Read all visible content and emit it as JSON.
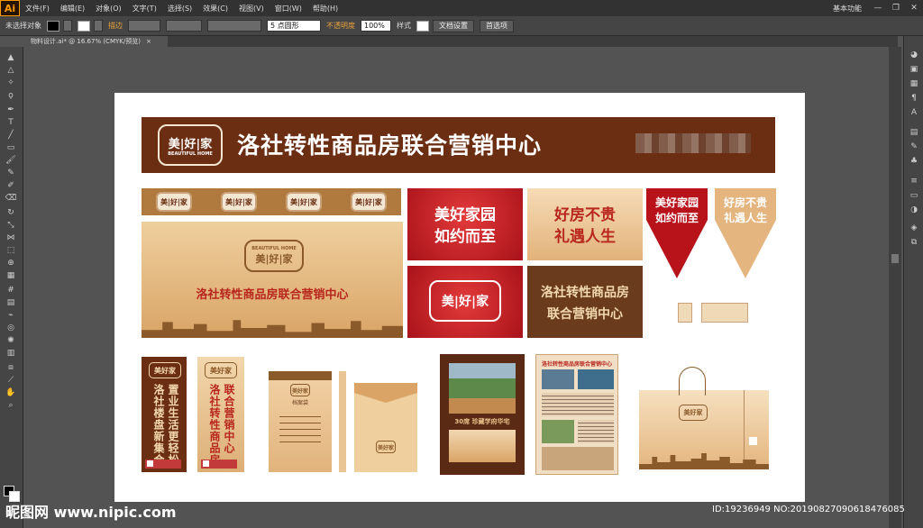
{
  "menubar": {
    "app_logo": "Ai",
    "items": [
      "文件(F)",
      "编辑(E)",
      "对象(O)",
      "文字(T)",
      "选择(S)",
      "效果(C)",
      "视图(V)",
      "窗口(W)",
      "帮助(H)"
    ],
    "workspace": "基本功能",
    "win_min": "—",
    "win_max": "❐",
    "win_close": "✕"
  },
  "ctrlbar": {
    "selection_status": "未选择对象",
    "stroke_label": "描边",
    "stroke_weight": "5 点圆形",
    "opacity_label": "不透明度",
    "opacity_value": "100%",
    "style_label": "样式",
    "doc_setup": "文档设置",
    "prefs": "首选项"
  },
  "document": {
    "tab_title": "物料设计.ai* @ 16.67% (CMYK/预览)",
    "tab_close": "×"
  },
  "artwork": {
    "banner_title": "洛社转性商品房联合营销中心",
    "logo_text": "美|好|家",
    "logo_text_small": "美好家",
    "logo_sub": "BEAUTIFUL HOME",
    "kt_title": "洛社转性商品房联合营销中心",
    "red_slogan_1": "美好家园",
    "red_slogan_2": "如约而至",
    "cream_slogan_1": "好房不贵",
    "cream_slogan_2": "礼遇人生",
    "brown_line_1": "洛社转性商品房",
    "brown_line_2": "联合营销中心",
    "pennant_red_1": "美好家园",
    "pennant_red_2": "如约而至",
    "pennant_cream_1": "好房不贵",
    "pennant_cream_2": "礼遇人生",
    "stand1_col_a": "洛社楼盘新集合",
    "stand1_col_b": "置业生活更轻松",
    "stand2_col_a": "洛社转性商品房",
    "stand2_col_b": "联合营销中心",
    "envelope_label": "档案袋",
    "poster_title": "30席 珍藏学府华宅",
    "flyer_title": "洛社转性商品房联合营销中心"
  },
  "watermark": {
    "left": "昵图网 www.nipic.com",
    "right": "ID:19236949 NO:20190827090618476085"
  }
}
